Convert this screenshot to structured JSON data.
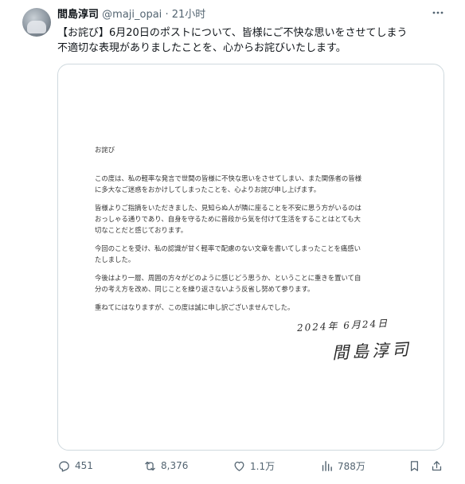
{
  "author": {
    "name": "間島淳司",
    "handle": "@maji_opai",
    "separator": "·",
    "time": "21小时"
  },
  "tweet": {
    "lines": [
      "【お詫び】6月20日のポストについて、皆様にご不快な思いをさせてしまう",
      "不適切な表現がありましたことを、心からお詫びいたします。"
    ]
  },
  "letter": {
    "greeting": "お詫び",
    "paragraphs": [
      [
        "この度は、私の軽率な発言で世間の皆様に不快な思いをさせてしまい、また関係者の皆様",
        "に多大なご迷惑をおかけしてしまったことを、心よりお詫び申し上げます。"
      ],
      [
        "皆様よりご指摘をいただきました、見知らぬ人が隣に座ることを不安に思う方がいるのは",
        "おっしゃる通りであり、自身を守るために普段から気を付けて生活をすることはとても大",
        "切なことだと感じております。"
      ],
      [
        "今回のことを受け、私の認識が甘く軽率で配慮のない文章を書いてしまったことを痛感い",
        "たしました。"
      ],
      [
        "今後はより一層、周囲の方々がどのように感じどう思うか、ということに重きを置いて自",
        "分の考え方を改め、同じことを繰り返さないよう反省し努めて参ります。"
      ],
      [
        "重ねてにはなりますが、この度は誠に申し訳ございませんでした。"
      ]
    ],
    "signature_date": "2024年 6月24日",
    "signature_name": "間島淳司"
  },
  "actions": {
    "replies": "451",
    "reposts": "8,376",
    "likes": "1.1万",
    "views": "788万"
  },
  "icons": [
    "more-icon",
    "reply-icon",
    "repost-icon",
    "like-icon",
    "views-icon",
    "bookmark-icon",
    "share-icon"
  ]
}
